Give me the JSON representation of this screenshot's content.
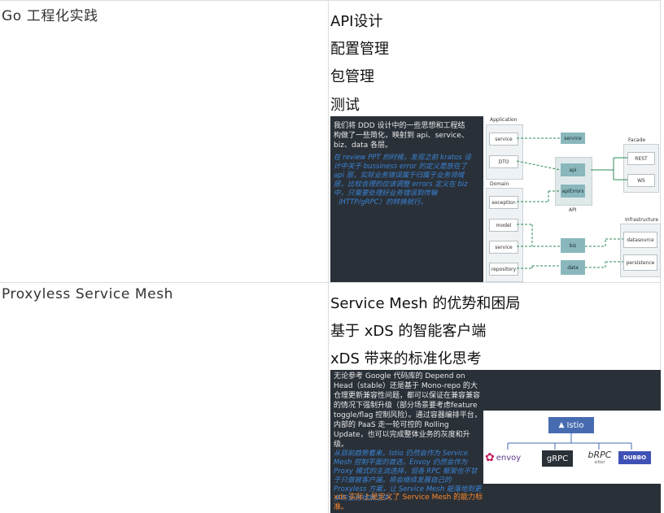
{
  "row1": {
    "topic": "Go 工程化实践",
    "items": [
      "API设计",
      "配置管理",
      "包管理",
      "测试"
    ],
    "slide": {
      "text_main": "我们将 DDD 设计中的一些思想和工程结构做了一些简化，映射到 api、service、biz、data 各层。",
      "text_italic": "在 review PPT 的时候，发现之前 kratos 设计中关于 bussiness error 的定义是放在了 api 层，实际业务错误属于归属于业务领域层，比较合理的应该调整 errors 定义在 biz 中，只需要处理好业务错误到传输（HTTP/gRPC）的转换就行。",
      "diagram": {
        "group_application": "Application",
        "group_domain": "Domain",
        "group_facade": "Facade",
        "group_infrastructure": "Infrastructure",
        "app_service": "service",
        "app_dto": "DTO",
        "dom_exception": "exception",
        "dom_model": "model",
        "dom_service": "service",
        "dom_repository": "repository",
        "api_service": "service",
        "api_api": "api",
        "api_apierrors": "apiErrors",
        "api_label": "API",
        "facade_rest": "REST",
        "facade_ws": "WS",
        "layer_biz": "biz",
        "layer_data": "data",
        "infra_datasource": "datasource",
        "infra_persistence": "persistence"
      }
    }
  },
  "row2": {
    "topic": "Proxyless Service Mesh",
    "items": [
      "Service Mesh 的优势和困局",
      "基于 xDS 的智能客户端",
      "xDS 带来的标准化思考"
    ],
    "slide": {
      "text_main": "无论参考 Google 代码库的 Depend on Head（stable）还是基于 Mono-repo 的大仓理更新兼容性问题，都可以保证在兼容兼容的情况下强制升级（部分场景要考虑feature toggle/flag 控制风险）。通过容器编排平台，内部的 PaaS 走一轮可控的 Rolling Update，也可以完成整体业务的灰度和升级。",
      "text_italic": "从目前趋势看来，Istio 仍然会作为 Service Mesh 控制平面的首选，Envoy 仍然会作为 Proxy 模式的主流选择，但各 RPC 框架也不甘于只做被客户端，将会继续发展自己的 Proxyless 方案，让 Service Mesh 能落地到更多的业务场景之中。",
      "text_orange": "xds 实际上是定义了 Service Mesh 的能力标准。",
      "logos": {
        "istio": "Istio",
        "envoy": "envoy",
        "grpc": "gRPC",
        "brpc": "bRPC",
        "brpc_sub": "sitter",
        "dubbo": "DUBBO"
      }
    }
  }
}
